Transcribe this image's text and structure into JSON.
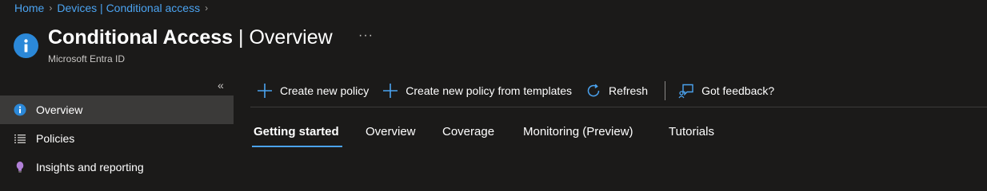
{
  "breadcrumb": {
    "items": [
      "Home",
      "Devices | Conditional access"
    ],
    "separator": "›"
  },
  "header": {
    "title_bold": "Conditional Access",
    "title_separator": " | ",
    "title_light": "Overview",
    "more_label": "···",
    "subtitle": "Microsoft Entra ID"
  },
  "sidebar": {
    "collapse_label": "«",
    "items": [
      {
        "label": "Overview",
        "icon": "info-icon",
        "selected": true
      },
      {
        "label": "Policies",
        "icon": "list-icon",
        "selected": false
      },
      {
        "label": "Insights and reporting",
        "icon": "lightbulb-icon",
        "selected": false
      }
    ]
  },
  "commands": {
    "create_policy": "Create new policy",
    "create_from_templates": "Create new policy from templates",
    "refresh": "Refresh",
    "feedback": "Got feedback?"
  },
  "tabs": [
    {
      "label": "Getting started",
      "active": true
    },
    {
      "label": "Overview",
      "active": false
    },
    {
      "label": "Coverage",
      "active": false
    },
    {
      "label": "Monitoring (Preview)",
      "active": false
    },
    {
      "label": "Tutorials",
      "active": false
    }
  ],
  "colors": {
    "background": "#1b1a19",
    "accent": "#4ba3f0",
    "selected_nav": "#3b3a39",
    "info_icon": "#2b88d8"
  }
}
